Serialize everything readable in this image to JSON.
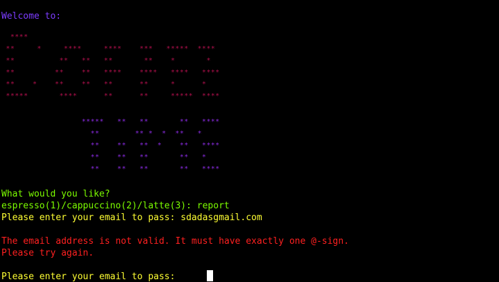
{
  "colors": {
    "background": "#000000",
    "welcome": "#7c3cff",
    "art_top": "#b0104c",
    "art_bottom": "#8a2be2",
    "prompt_green": "#7cfc00",
    "prompt_yellow": "#ffff33",
    "error_red": "#ff2020",
    "cursor": "#ffffff"
  },
  "welcome": "Welcome to:",
  "art_top": "  ****\n **     *     ****     ****    ***   *****  ****\n **          **   **   **       **    *       *\n **         **    **   ****    ****   ****   ****\n **    *    **    **   **      **     *      *\n *****       ****      **      **     *****  ****",
  "art_bottom": "                  *****   **   **       **   ****\n                    **        ** *  *  **   *\n                    **    **   **  *    **   ****\n                    **    **   **       **   *\n                    **    **   **       **   ****",
  "question": "What would you like?",
  "options_prompt": "espresso(1)/cappuccino(2)/latte(3): report",
  "email_prompt_first": "Please enter your email to pass: sdadasgmail.com",
  "error_line1": "The email address is not valid. It must have exactly one @-sign.",
  "error_line2": "Please try again.",
  "email_prompt_second": "Please enter your email to pass: "
}
